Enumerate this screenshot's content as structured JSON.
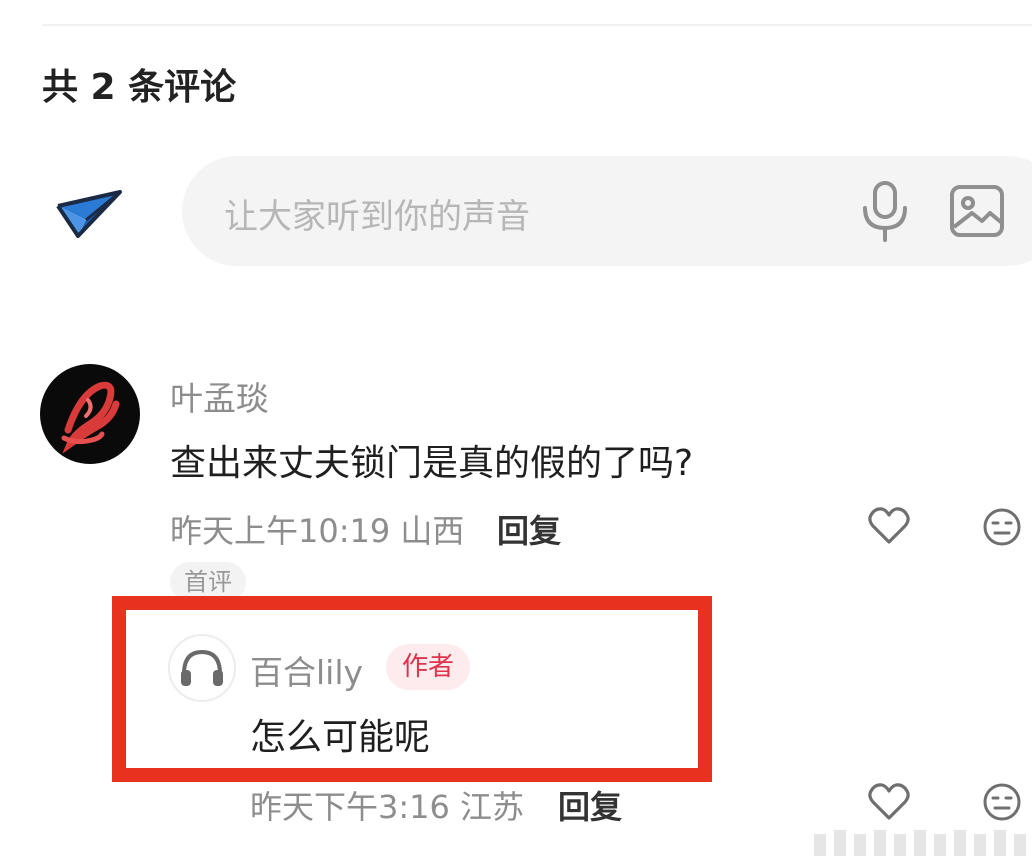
{
  "header": {
    "comment_count_title": "共 2 条评论"
  },
  "composer": {
    "send_icon": "paper-plane-icon",
    "placeholder": "让大家听到你的声音",
    "mic_icon": "microphone-icon",
    "image_icon": "image-icon"
  },
  "comments": [
    {
      "username": "叶孟琰",
      "avatar": "red-scribble-avatar",
      "text": "查出来丈夫锁门是真的假的了吗?",
      "time_location": "昨天上午10:19 山西",
      "reply_label": "回复",
      "tag": "首评",
      "icons": [
        "heart-icon",
        "expressionless-face-icon"
      ]
    }
  ],
  "replies": [
    {
      "username": "百合lily",
      "avatar": "headphones-avatar",
      "badge": "作者",
      "text": "怎么可能呢",
      "time_location": "昨天下午3:16 江苏",
      "reply_label": "回复",
      "icons": [
        "heart-icon",
        "expressionless-face-icon"
      ]
    }
  ],
  "colors": {
    "highlight_border": "#e8321f",
    "author_badge_text": "#e0324a",
    "author_badge_bg": "#fdebee",
    "send_icon_blue": "#2b7bd6"
  }
}
